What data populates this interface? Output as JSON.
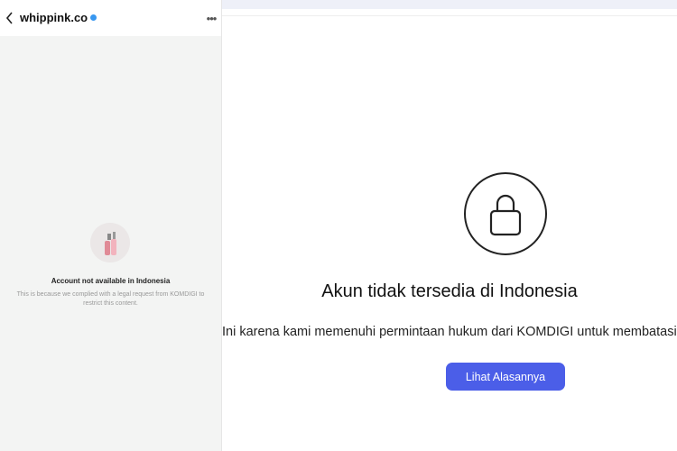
{
  "left_panel": {
    "header": {
      "username": "whippink.co"
    },
    "title": "Account not available in Indonesia",
    "message": "This is because we complied with a legal request from KOMDIGI to restrict this content."
  },
  "right_panel": {
    "title": "Akun tidak tersedia di Indonesia",
    "message": "Ini karena kami memenuhi permintaan hukum dari KOMDIGI untuk membatasi konten ini.",
    "button_label": "Lihat Alasannya"
  },
  "icons": {
    "back": "chevron-left-icon",
    "verified": "verified-badge-icon",
    "more": "more-options-icon",
    "lock": "lock-icon"
  },
  "colors": {
    "button": "#4b5ee8",
    "verified": "#3897f0"
  }
}
